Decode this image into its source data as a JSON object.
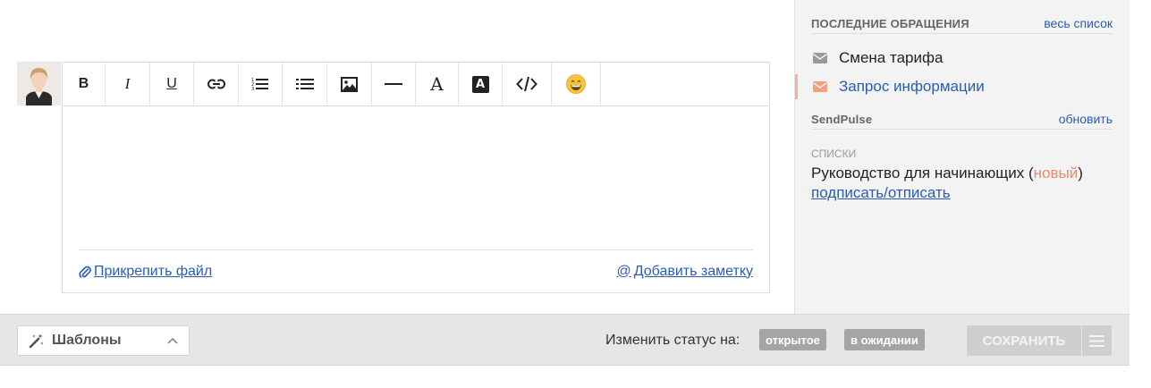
{
  "toolbar": {
    "buttons": [
      {
        "name": "bold",
        "label": "B"
      },
      {
        "name": "italic",
        "label": "I"
      },
      {
        "name": "underline",
        "label": "U"
      },
      {
        "name": "link"
      },
      {
        "name": "ordered-list"
      },
      {
        "name": "unordered-list"
      },
      {
        "name": "image"
      },
      {
        "name": "horizontal-rule"
      },
      {
        "name": "text-color",
        "label": "A"
      },
      {
        "name": "background-color",
        "label": "A"
      },
      {
        "name": "code"
      },
      {
        "name": "emoji"
      }
    ]
  },
  "editor": {
    "attach_label": "Прикрепить файл",
    "note_label": "Добавить заметку"
  },
  "sidebar": {
    "recent": {
      "title": "ПОСЛЕДНИЕ ОБРАЩЕНИЯ",
      "link": "весь список",
      "items": [
        {
          "label": "Смена тарифа",
          "icon": "envelope-icon",
          "color": "#9a9a9a",
          "active": false
        },
        {
          "label": "Запрос информации",
          "icon": "envelope-icon",
          "color": "#f0a080",
          "active": true
        }
      ]
    },
    "sendpulse": {
      "title": "SendPulse",
      "link": "обновить",
      "lists_label": "СПИСКИ",
      "list_name": "Руководство для начинающих (",
      "list_status": "новый",
      "list_close": ")",
      "subscribe_link": "подписать/отписать"
    }
  },
  "bottom": {
    "templates_label": "Шаблоны",
    "status_label": "Изменить статус на:",
    "status_open": "открытое",
    "status_pending": "в ожидании",
    "save_label": "СОХРАНИТЬ"
  },
  "colors": {
    "link": "#2a5db0",
    "accent_new": "#ee8a6b",
    "active_marker": "#f0b49a"
  }
}
